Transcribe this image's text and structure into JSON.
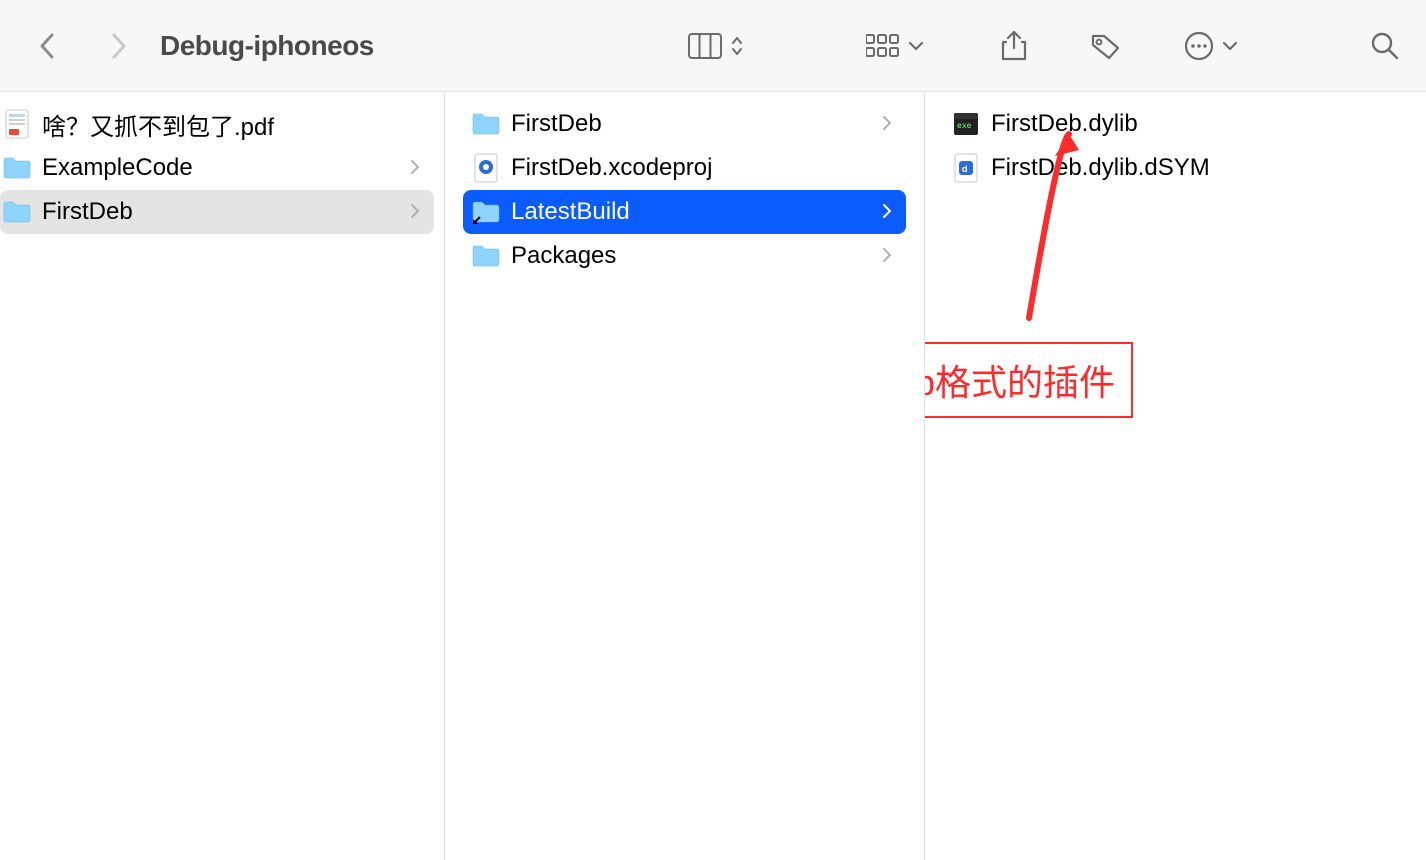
{
  "header": {
    "title": "Debug-iphoneos"
  },
  "toolbar_icons": {
    "back": "back-chevron",
    "forward": "forward-chevron",
    "view_columns": "columns-icon",
    "view_dropdown": "updown-icon",
    "group_icons": "group-icon",
    "group_dropdown": "chevron-down-icon",
    "share": "share-icon",
    "tags": "tag-icon",
    "more": "more-icon",
    "more_dropdown": "chevron-down-icon",
    "search": "search-icon"
  },
  "columns": {
    "col1": [
      {
        "name": "啥？又抓不到包了.pdf",
        "icon": "pdf",
        "selected": false,
        "hasChildren": false
      },
      {
        "name": "ExampleCode",
        "icon": "folder",
        "selected": false,
        "hasChildren": true
      },
      {
        "name": "FirstDeb",
        "icon": "folder",
        "selected": "grey",
        "hasChildren": true
      }
    ],
    "col2": [
      {
        "name": "FirstDeb",
        "icon": "folder",
        "selected": false,
        "hasChildren": true
      },
      {
        "name": "FirstDeb.xcodeproj",
        "icon": "xcodeproj",
        "selected": false,
        "hasChildren": false
      },
      {
        "name": "LatestBuild",
        "icon": "folder-alias",
        "selected": "blue",
        "hasChildren": true
      },
      {
        "name": "Packages",
        "icon": "folder",
        "selected": false,
        "hasChildren": true
      }
    ],
    "col3": [
      {
        "name": "FirstDeb.dylib",
        "icon": "exec",
        "selected": false,
        "hasChildren": false
      },
      {
        "name": "FirstDeb.dylib.dSYM",
        "icon": "dsym",
        "selected": false,
        "hasChildren": false
      }
    ]
  },
  "annotation": {
    "text": "这则是dylib格式的插件",
    "color": "#ff2a2a"
  }
}
